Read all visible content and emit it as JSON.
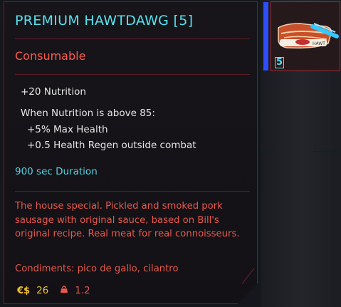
{
  "item": {
    "name": "PREMIUM HAWTDAWG [5]",
    "category": "Consumable",
    "stats": [
      "+20 Nutrition",
      "When Nutrition is above 85:",
      "+5% Max Health",
      "+0.5 Health Regen outside combat"
    ],
    "duration": "900 sec Duration",
    "description": "The house special. Pickled and smoked pork sausage with original sauce, based on Bill's original recipe. Real meat for real connoisseurs.",
    "condiments": "Condiments: pico de gallo, cilantro",
    "price_icon": "€$",
    "price": "26",
    "weight": "1.2",
    "weight_icon": "weight-icon"
  },
  "slot": {
    "count": "5",
    "image_icon": "hotdog-icon"
  },
  "colors": {
    "title": "#56e1ef",
    "category": "#ff5a4f",
    "description": "#e8584c",
    "price": "#f2c230",
    "border": "#6e2227",
    "slot_accent": "#2f4fff"
  }
}
